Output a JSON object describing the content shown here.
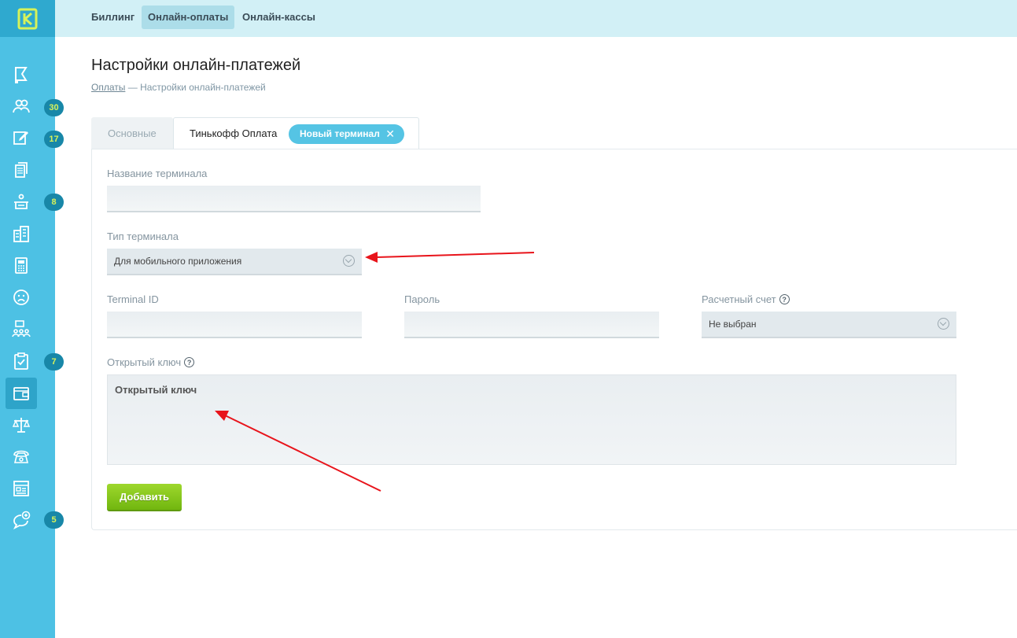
{
  "colors": {
    "sidebar": "#4dc1e4",
    "topbar": "#d2f0f6",
    "accent": "#55c4e4",
    "badge_text": "#d7f25a",
    "button": "#84c51c",
    "annotation_arrow": "#e8141b"
  },
  "logo": {
    "letter": "K"
  },
  "sidebar": {
    "items": [
      {
        "icon": "flag-icon",
        "badge": ""
      },
      {
        "icon": "users-icon",
        "badge": "30"
      },
      {
        "icon": "edit-note-icon",
        "badge": "17"
      },
      {
        "icon": "documents-icon",
        "badge": ""
      },
      {
        "icon": "teacher-desk-icon",
        "badge": "8"
      },
      {
        "icon": "building-icon",
        "badge": ""
      },
      {
        "icon": "calculator-icon",
        "badge": ""
      },
      {
        "icon": "sad-face-icon",
        "badge": ""
      },
      {
        "icon": "org-structure-icon",
        "badge": ""
      },
      {
        "icon": "clipboard-check-icon",
        "badge": "7"
      },
      {
        "icon": "wallet-icon",
        "badge": "",
        "active": true
      },
      {
        "icon": "scales-icon",
        "badge": ""
      },
      {
        "icon": "phone-icon",
        "badge": ""
      },
      {
        "icon": "browser-window-icon",
        "badge": ""
      },
      {
        "icon": "chat-add-icon",
        "badge": "5"
      }
    ]
  },
  "topbar": {
    "tabs": [
      "Биллинг",
      "Онлайн-оплаты",
      "Онлайн-кассы"
    ],
    "active": "Онлайн-оплаты"
  },
  "page": {
    "title": "Настройки онлайн-платежей",
    "breadcrumb_link": "Оплаты",
    "breadcrumb_sep": "—",
    "breadcrumb_current": "Настройки онлайн-платежей"
  },
  "tabs": {
    "basic": "Основные",
    "tinkoff": "Тинькофф Оплата",
    "new_terminal": "Новый терминал",
    "close": "✕"
  },
  "form": {
    "terminal_name_label": "Название терминала",
    "terminal_name_value": "",
    "terminal_type_label": "Тип терминала",
    "terminal_type_value": "Для мобильного приложения",
    "terminal_id_label": "Terminal ID",
    "terminal_id_value": "",
    "password_label": "Пароль",
    "password_value": "",
    "account_label": "Расчетный счет",
    "account_value": "Не выбран",
    "public_key_label": "Открытый ключ",
    "public_key_value": "Открытый ключ",
    "help": "?",
    "submit": "Добавить"
  }
}
